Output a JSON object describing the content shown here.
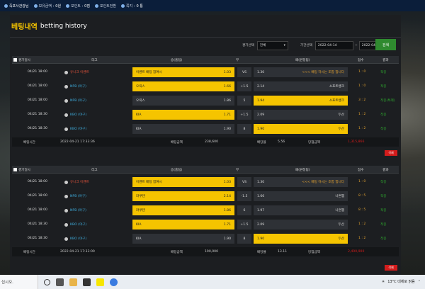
{
  "topbar": {
    "user": "즉포사관광님",
    "money_label": "보유금액 :",
    "money_value": "0원",
    "point_label": "포인트 :",
    "point_value": "0점",
    "coupon_label": "포인트전환",
    "message_label": "쪽지 :",
    "message_value": "0 통"
  },
  "page": {
    "title_ko": "베팅내역",
    "title_en": "betting history"
  },
  "filter": {
    "game_label": "경기선택",
    "game_value": "전체",
    "period_label": "기간선택",
    "date_from": "2022-04-14",
    "date_to": "2022-04-21",
    "search_label": "검색"
  },
  "table_headers": {
    "time": "경기일시",
    "league": "리그",
    "home": "승(홈팀)",
    "vs": "무",
    "away": "패(원정팀)",
    "score": "점수",
    "result": "결과"
  },
  "bets": [
    {
      "rows": [
        {
          "time": "04/21 18:00",
          "league": "유니크 이벤트",
          "league_color": "#e0523b",
          "home": "이벤트 배팅 참여시",
          "home_odds": "1.03",
          "home_sel": true,
          "mid": "VS",
          "away_odds": "1.30",
          "away": "<<< 배팅 하시는 조합 합니다",
          "away_sel": false,
          "score": "1 : 0",
          "result": "적중"
        },
        {
          "time": "04/21 18:00",
          "league": "NPB (야구)",
          "league_color": "#3fb0e0",
          "home": "오릭스",
          "home_odds": "1.66",
          "home_sel": true,
          "mid": "+1.5",
          "away_odds": "2.14",
          "away": "소프트뱅크",
          "away_sel": false,
          "score": "1 : 0",
          "result": "적중"
        },
        {
          "time": "04/21 18:00",
          "league": "NPB (야구)",
          "league_color": "#3fb0e0",
          "home": "오릭스",
          "home_odds": "1.86",
          "home_sel": false,
          "mid": "5",
          "away_odds": "1.94",
          "away": "소프트뱅크",
          "away_sel": true,
          "score": "3 : 2",
          "result": "적중(특례)"
        },
        {
          "time": "04/21 18:30",
          "league": "KBO (야구)",
          "league_color": "#3fb0e0",
          "home": "KIA",
          "home_odds": "1.71",
          "home_sel": true,
          "mid": "+1.5",
          "away_odds": "2.09",
          "away": "두산",
          "away_sel": false,
          "score": "1 : 2",
          "result": "적중"
        },
        {
          "time": "04/21 18:30",
          "league": "KBO (야구)",
          "league_color": "#3fb0e0",
          "home": "KIA",
          "home_odds": "1.90",
          "home_sel": false,
          "mid": "8",
          "away_odds": "1.90",
          "away": "두산",
          "away_sel": true,
          "score": "1 : 2",
          "result": "적중"
        }
      ],
      "summary": {
        "bet_time_label": "배팅시간",
        "bet_time": "2022-04-21 17:33:36",
        "amount_label": "배팅금액",
        "amount": "238,600",
        "odds_label": "배당율",
        "odds": "5.56",
        "win_label": "당첨금액",
        "win": "1,315,866",
        "delete_label": "삭제"
      }
    },
    {
      "rows": [
        {
          "time": "04/21 18:00",
          "league": "유니크 이벤트",
          "league_color": "#e0523b",
          "home": "이벤트 배팅 참여시",
          "home_odds": "1.03",
          "home_sel": true,
          "mid": "VS",
          "away_odds": "1.30",
          "away": "<<< 배팅 하시는 조합 합니다",
          "away_sel": false,
          "score": "1 : 0",
          "result": "적중"
        },
        {
          "time": "04/21 18:00",
          "league": "NPB (야구)",
          "league_color": "#3fb0e0",
          "home": "라쿠텐",
          "home_odds": "2.14",
          "home_sel": true,
          "mid": "-1.5",
          "away_odds": "1.66",
          "away": "니혼햄",
          "away_sel": false,
          "score": "8 : 5",
          "result": "적중"
        },
        {
          "time": "04/21 18:00",
          "league": "NPB (야구)",
          "league_color": "#3fb0e0",
          "home": "라쿠텐",
          "home_odds": "1.86",
          "home_sel": true,
          "mid": "6",
          "away_odds": "1.97",
          "away": "니혼햄",
          "away_sel": false,
          "score": "8 : 5",
          "result": "적중"
        },
        {
          "time": "04/21 18:30",
          "league": "KBO (야구)",
          "league_color": "#3fb0e0",
          "home": "KIA",
          "home_odds": "1.71",
          "home_sel": true,
          "mid": "+1.5",
          "away_odds": "2.09",
          "away": "두산",
          "away_sel": false,
          "score": "1 : 2",
          "result": "적중"
        },
        {
          "time": "04/21 18:30",
          "league": "KBO (야구)",
          "league_color": "#3fb0e0",
          "home": "KIA",
          "home_odds": "1.90",
          "home_sel": false,
          "mid": "8",
          "away_odds": "1.90",
          "away": "두산",
          "away_sel": true,
          "score": "1 : 2",
          "result": "적중"
        }
      ],
      "summary": {
        "bet_time_label": "배팅시간",
        "bet_time": "2022-04-21 17:33:00",
        "amount_label": "배팅금액",
        "amount": "190,000",
        "odds_label": "배당율",
        "odds": "13.11",
        "win_label": "당첨금액",
        "win": "2,490,900",
        "delete_label": "삭제"
      }
    }
  ],
  "taskbar": {
    "search": "십시오.",
    "weather": "13°C  대체로 맑음"
  },
  "colors": {
    "accent": "#f5c400",
    "win": "#2ea52e",
    "lose": "#d21c1c",
    "score": "#e0a030"
  }
}
